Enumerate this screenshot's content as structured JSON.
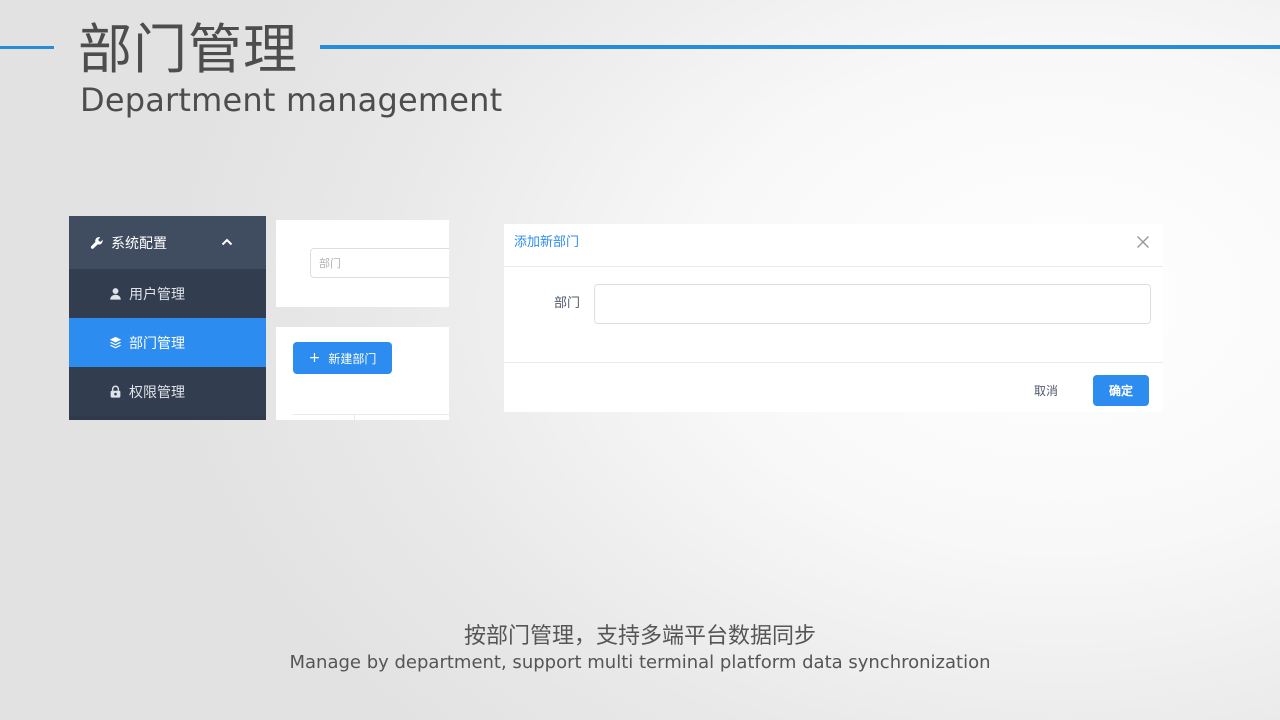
{
  "header": {
    "title": "部门管理",
    "subtitle": "Department management",
    "accent_color": "#2a8bd6"
  },
  "sidebar": {
    "group": {
      "label": "系统配置",
      "icon": "wrench-icon",
      "expanded_icon": "chevron-up-icon"
    },
    "items": [
      {
        "label": "用户管理",
        "icon": "user-icon",
        "active": false
      },
      {
        "label": "部门管理",
        "icon": "layers-icon",
        "active": true
      },
      {
        "label": "权限管理",
        "icon": "lock-icon",
        "active": false
      }
    ],
    "active_color": "#2d8cf0"
  },
  "filter": {
    "placeholder": "部门"
  },
  "toolbar": {
    "new_department_label": "新建部门",
    "new_department_icon": "plus-icon"
  },
  "modal": {
    "title": "添加新部门",
    "close_icon": "close-icon",
    "field_label": "部门",
    "field_value": "",
    "cancel_label": "取消",
    "confirm_label": "确定"
  },
  "captions": {
    "chinese": "按部门管理，支持多端平台数据同步",
    "english": "Manage by department, support multi terminal platform data synchronization"
  }
}
